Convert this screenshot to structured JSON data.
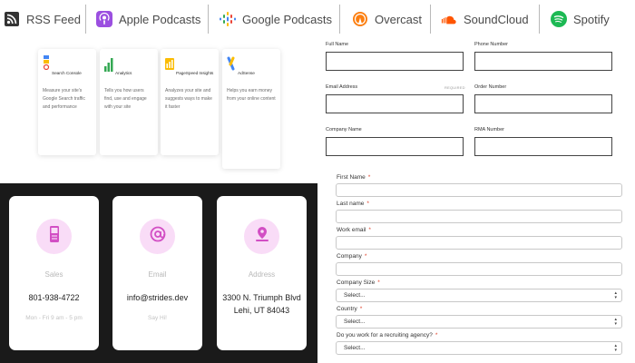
{
  "podcasts": {
    "items": [
      {
        "label": "RSS Feed",
        "icon": "rss-icon",
        "color": "#333333"
      },
      {
        "label": "Apple Podcasts",
        "icon": "apple-podcasts-icon",
        "color": "#9b4fe0"
      },
      {
        "label": "Google Podcasts",
        "icon": "google-podcasts-icon",
        "color": "#4285f4"
      },
      {
        "label": "Overcast",
        "icon": "overcast-icon",
        "color": "#fc7e0f"
      },
      {
        "label": "SoundCloud",
        "icon": "soundcloud-icon",
        "color": "#ff5500"
      },
      {
        "label": "Spotify",
        "icon": "spotify-icon",
        "color": "#1db954"
      }
    ]
  },
  "google_tools": {
    "cards": [
      {
        "title": "Search Console",
        "description": "Measure your site's Google Search traffic and performance",
        "icon": "search-console-icon"
      },
      {
        "title": "Analytics",
        "description": "Tells you how users find, use and engage with your site",
        "icon": "analytics-icon"
      },
      {
        "title": "PageSpeed Insights",
        "description": "Analyzes your site and suggests ways to make it faster",
        "icon": "pagespeed-insights-icon"
      },
      {
        "title": "AdSense",
        "description": "Helps you earn money from your online content",
        "icon": "adsense-icon"
      }
    ]
  },
  "contact": {
    "accent": "#d24ec4",
    "cards": [
      {
        "label": "Sales",
        "value": "801-938-4722",
        "note": "Mon - Fri 9 am - 5 pm",
        "icon": "phone-icon"
      },
      {
        "label": "Email",
        "value": "info@strides.dev",
        "note": "Say Hi!",
        "icon": "at-sign-icon"
      },
      {
        "label": "Address",
        "value": "3300 N. Triumph Blvd",
        "value2": "Lehi, UT 84043",
        "icon": "map-pin-icon"
      }
    ]
  },
  "form_a": {
    "full_name": "Full Name",
    "phone_number": "Phone Number",
    "email_address": "Email Address",
    "required": "REQUIRED",
    "order_number": "Order Number",
    "company_name": "Company Name",
    "rma_number": "RMA Number"
  },
  "form_b": {
    "required_mark": "*",
    "first_name": "First Name",
    "last_name": "Last name",
    "work_email": "Work email",
    "company": "Company",
    "company_size": "Company Size",
    "company_size_value": "Select...",
    "country": "Country",
    "country_value": "Select...",
    "recruiting": "Do you work for a recruiting agency?",
    "recruiting_value": "Select..."
  }
}
